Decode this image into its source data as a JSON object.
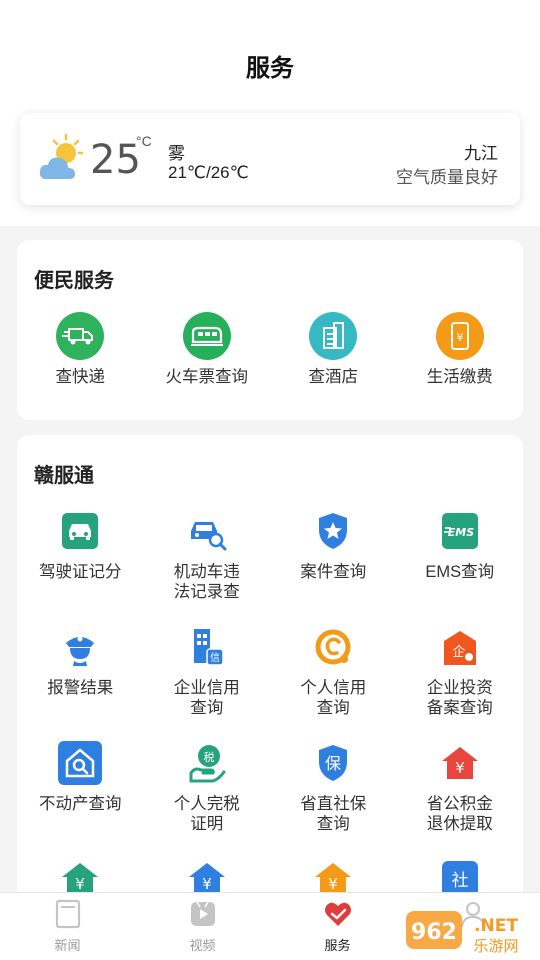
{
  "header": {
    "title": "服务"
  },
  "weather": {
    "temperature": "25",
    "unit": "°C",
    "condition": "雾",
    "range": "21℃/26℃",
    "city": "九江",
    "air_quality": "空气质量良好"
  },
  "bianmin": {
    "title": "便民服务",
    "items": [
      {
        "label": "查快递",
        "icon": "express-truck-icon",
        "color": "#2eb25b"
      },
      {
        "label": "火车票查询",
        "icon": "train-icon",
        "color": "#26b05a"
      },
      {
        "label": "查酒店",
        "icon": "hotel-building-icon",
        "color": "#36b9c4"
      },
      {
        "label": "生活缴费",
        "icon": "phone-bill-icon",
        "color": "#f49a16"
      }
    ]
  },
  "ganfutong": {
    "title": "赣服通",
    "items": [
      {
        "label": "驾驶证记分",
        "icon": "car-icon",
        "color": "#26a37d"
      },
      {
        "label": "机动车违法记录查",
        "icon": "car-search-icon",
        "color": "#2f7fe0"
      },
      {
        "label": "案件查询",
        "icon": "star-shield-icon",
        "color": "#2f7fe0"
      },
      {
        "label": "EMS查询",
        "icon": "ems-icon",
        "color": "#26a37d"
      },
      {
        "label": "报警结果",
        "icon": "police-icon",
        "color": "#2f7fe0"
      },
      {
        "label": "企业信用查询",
        "icon": "enterprise-credit-icon",
        "color": "#2f7fe0"
      },
      {
        "label": "个人信用查询",
        "icon": "personal-credit-icon",
        "color": "#f49a16"
      },
      {
        "label": "企业投资备案查询",
        "icon": "enterprise-invest-icon",
        "color": "#f0561d"
      },
      {
        "label": "不动产查询",
        "icon": "house-search-icon",
        "color": "#2f7fe0"
      },
      {
        "label": "个人完税证明",
        "icon": "tax-hand-icon",
        "color": "#26a37d"
      },
      {
        "label": "省直社保查询",
        "icon": "social-security-shield-icon",
        "color": "#2f7fe0"
      },
      {
        "label": "省公积金退休提取",
        "icon": "fund-house-icon",
        "color": "#e8463c"
      },
      {
        "label": "",
        "icon": "fund-house-green-icon",
        "color": "#26a37d"
      },
      {
        "label": "",
        "icon": "fund-house-blue-icon",
        "color": "#2f7fe0"
      },
      {
        "label": "",
        "icon": "fund-house-orange-icon",
        "color": "#f49a16"
      },
      {
        "label": "社",
        "icon": "social-card-icon",
        "color": "#2f7fe0"
      }
    ]
  },
  "tabbar": {
    "tabs": [
      {
        "label": "新闻",
        "icon": "news-icon",
        "active": false
      },
      {
        "label": "视频",
        "icon": "video-icon",
        "active": false
      },
      {
        "label": "服务",
        "icon": "service-heart-icon",
        "active": true
      },
      {
        "label": "",
        "icon": "profile-icon",
        "active": false
      }
    ]
  },
  "watermark": {
    "text": "962.NET",
    "subtext": "乐游网"
  }
}
